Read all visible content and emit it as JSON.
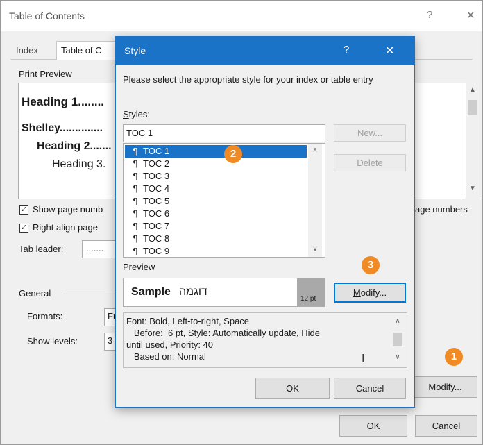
{
  "toc_dialog": {
    "title": "Table of Contents",
    "help": "?",
    "close": "✕",
    "tabs": [
      "Index",
      "Table of C"
    ],
    "print_preview_label": "Print Preview",
    "preview_lines": [
      "Heading 1........",
      "Shelley..............",
      "Heading 2.......",
      "Heading 3."
    ],
    "show_page_numbers": "Show page numb",
    "right_align": "Right align page",
    "hyperlinks_suffix": "age numbers",
    "tab_leader_label": "Tab leader:",
    "tab_leader_value": ".......",
    "general_label": "General",
    "formats_label": "Formats:",
    "formats_value": "Fr",
    "show_levels_label": "Show levels:",
    "show_levels_value": "3",
    "modify_button": "Modify...",
    "ok_button": "OK",
    "cancel_button": "Cancel"
  },
  "style_dialog": {
    "title": "Style",
    "help": "?",
    "close": "✕",
    "instruction": "Please select the appropriate style for your index or table entry",
    "styles_label": "Styles:",
    "styles_input_value": "TOC 1",
    "styles_list": [
      "TOC 1",
      "TOC 2",
      "TOC 3",
      "TOC 4",
      "TOC 5",
      "TOC 6",
      "TOC 7",
      "TOC 8",
      "TOC 9"
    ],
    "selected_index": 0,
    "pilcrow": "¶",
    "new_button": "New...",
    "delete_button": "Delete",
    "preview_label": "Preview",
    "preview_sample": "Sample",
    "preview_hebrew": "דוגמה",
    "preview_size": "12 pt",
    "modify_button": "Modify...",
    "description": [
      "Font: Bold, Left-to-right, Space",
      "   Before:  6 pt, Style: Automatically update, Hide",
      "until used, Priority: 40",
      "   Based on: Normal"
    ],
    "ok_button": "OK",
    "cancel_button": "Cancel"
  },
  "badges": [
    "1",
    "2",
    "3"
  ],
  "colors": {
    "accent": "#1a73c6",
    "badge": "#f08a24",
    "selection": "#cce4f7"
  }
}
